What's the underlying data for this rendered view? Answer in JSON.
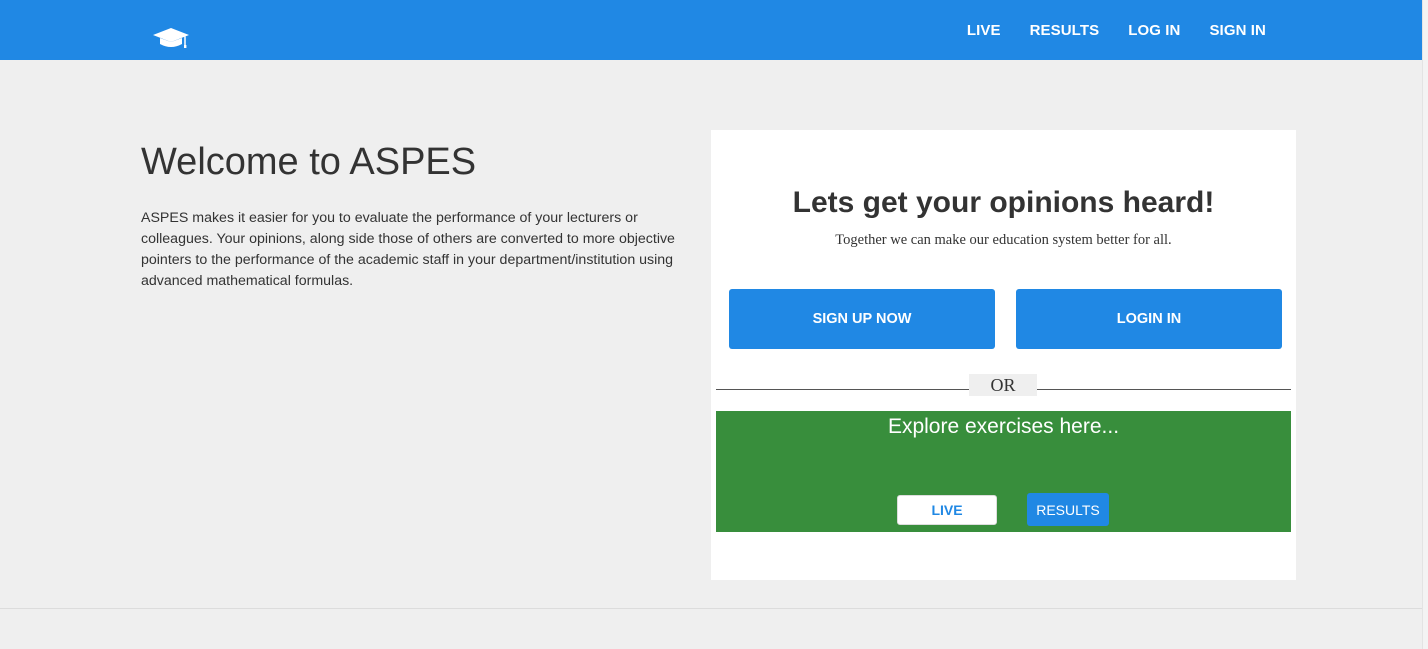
{
  "colors": {
    "primary": "#2088e4",
    "explore_green": "#388e3c",
    "background": "#efefef"
  },
  "navbar": {
    "logo_icon": "graduation-cap-icon",
    "links": [
      "LIVE",
      "RESULTS",
      "LOG IN",
      "SIGN IN"
    ]
  },
  "intro": {
    "title": "Welcome to ASPES",
    "description": "ASPES makes it easier for you to evaluate the performance of your lecturers or colleagues. Your opinions, along side those of others are converted to more objective pointers to the performance of the academic staff in your department/institution using advanced mathematical formulas."
  },
  "card": {
    "heading": "Lets get your opinions heard!",
    "tagline": "Together we can make our education system better for all.",
    "signup_label": "SIGN UP NOW",
    "login_label": "LOGIN IN",
    "or_label": "OR",
    "explore": {
      "title": "Explore exercises here...",
      "live_label": "LIVE",
      "results_label": "RESULTS"
    }
  }
}
